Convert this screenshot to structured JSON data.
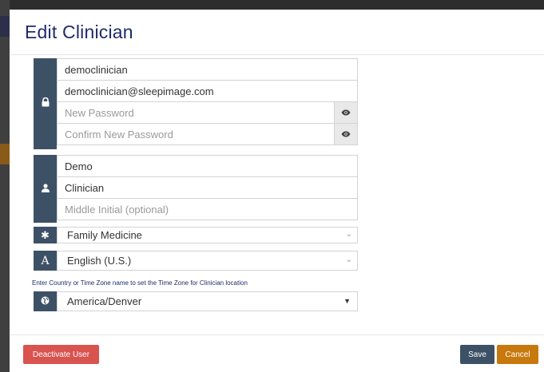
{
  "modal": {
    "title": "Edit Clinician"
  },
  "account": {
    "icon": "lock-icon",
    "username": "democlinician",
    "email": "democlinician@sleepimage.com",
    "new_password_placeholder": "New Password",
    "confirm_password_placeholder": "Confirm New Password",
    "show_password_icon": "eye-icon"
  },
  "name": {
    "icon": "user-icon",
    "first": "Demo",
    "last": "Clinician",
    "middle_placeholder": "Middle Initial (optional)"
  },
  "specialty": {
    "icon": "asterisk-icon",
    "selected": "Family Medicine"
  },
  "language": {
    "icon": "language-icon",
    "selected": "English (U.S.)"
  },
  "timezone": {
    "hint": "Enter Country or Time Zone name to set the Time Zone for Clinician location",
    "icon": "globe-icon",
    "selected": "America/Denver"
  },
  "footer": {
    "deactivate_label": "Deactivate User",
    "save_label": "Save",
    "cancel_label": "Cancel"
  },
  "colors": {
    "title": "#1f2b6b",
    "addon": "#3d5166",
    "deactivate": "#d9534f",
    "save": "#3d5166",
    "cancel": "#c8790e"
  }
}
